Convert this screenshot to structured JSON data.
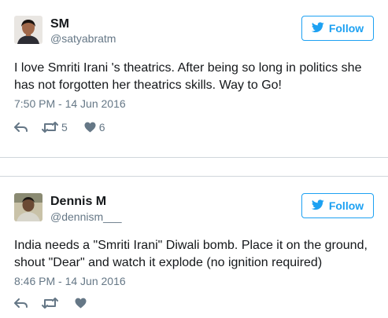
{
  "colors": {
    "accent": "#1da1f2",
    "muted": "#657786",
    "text": "#14171a",
    "border": "#d0d6db"
  },
  "tweets": [
    {
      "name": "SM",
      "handle": "@satyabratm",
      "follow_label": "Follow",
      "text": "I love Smriti Irani 's theatrics. After being so long in politics she has not forgotten her theatrics skills. Way to Go!",
      "time": "7:50 PM - 14 Jun 2016",
      "retweets": "5",
      "likes": "6",
      "icons": [
        "reply-icon",
        "retweet-icon",
        "heart-icon",
        "twitter-bird-icon"
      ]
    },
    {
      "name": "Dennis M",
      "handle": "@dennism___",
      "follow_label": "Follow",
      "text": "India needs a \"Smriti Irani\" Diwali bomb. Place it on the ground, shout \"Dear\" and watch it explode (no ignition required)",
      "time": "8:46 PM - 14 Jun 2016",
      "icons": [
        "reply-icon",
        "retweet-icon",
        "heart-icon",
        "twitter-bird-icon"
      ]
    }
  ]
}
